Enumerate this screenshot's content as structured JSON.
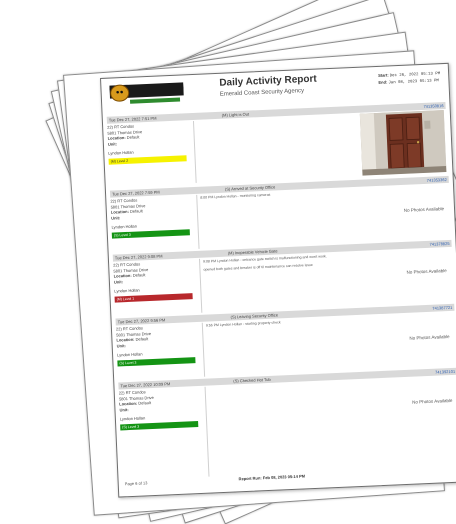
{
  "report": {
    "title": "Daily Activity Report",
    "agency": "Emerald Coast Security Agency",
    "start_label": "Start:",
    "start_value": "Dec 26, 2022 05:13 PM",
    "end_label": "End:",
    "end_value": "Jan 08, 2023 05:13 PM",
    "logo_text_top": "EMERALD COAST",
    "logo_text_bottom": "SECURITY AGENCY"
  },
  "entries": [
    {
      "datetime": "Tue Dec 27, 2022 7:51 PM",
      "event": "(M) Light is Out",
      "id": "741350816",
      "property": "22) RT Condos",
      "address": "5801 Thomas Drive",
      "location_label": "Location:",
      "location": "Default",
      "unit_label": "Unit:",
      "officer": "Lyndon Hollan",
      "level": "(M) Level 2",
      "level_color": "#f6f200",
      "note": "",
      "photo": true,
      "photo_text": ""
    },
    {
      "datetime": "Tue Dec 27, 2022 7:59 PM",
      "event": "(S) Arrived at Security Office",
      "id": "741353362",
      "property": "22) RT Condos",
      "address": "5801 Thomas Drive",
      "location_label": "Location:",
      "location": "Default",
      "unit_label": "Unit:",
      "officer": "Lyndon Hollan",
      "level": "(S) Level 3",
      "level_color": "#149414",
      "note": "8:00 PM Lyndon Hollan - monitoring cameras",
      "photo": false,
      "photo_text": "No Photos Available"
    },
    {
      "datetime": "Tue Dec 27, 2022 9:08 PM",
      "event": "(M) Inoperable Vehicle Gate",
      "id": "741378825",
      "property": "22) RT Condos",
      "address": "5801 Thomas Drive",
      "location_label": "Location:",
      "location": "Default",
      "unit_label": "Unit:",
      "officer": "Lyndon Hollan",
      "level": "(M) Level 1",
      "level_color": "#b8282c",
      "note": "9:08 PM Lyndon Hollan - entrance gate switch is malfunctioning and won't work.",
      "note2": "opened both gates and breaker is off til maintenance can resolve issue",
      "photo": false,
      "photo_text": "No Photos Available"
    },
    {
      "datetime": "Tue Dec 27, 2022 9:56 PM",
      "event": "(S) Leaving Security Office",
      "id": "741387721",
      "property": "22) RT Condos",
      "address": "5801 Thomas Drive",
      "location_label": "Location:",
      "location": "Default",
      "unit_label": "Unit:",
      "officer": "Lyndon Hollan",
      "level": "(S) Level 3",
      "level_color": "#149414",
      "note": "9:56 PM Lyndon Hollan - starting property check",
      "photo": false,
      "photo_text": "No Photos Available"
    },
    {
      "datetime": "Tue Dec 27, 2022 10:09 PM",
      "event": "(S) Checked Hot Tub",
      "id": "741392101",
      "property": "22) RT Condos",
      "address": "5801 Thomas Drive",
      "location_label": "Location:",
      "location": "Default",
      "unit_label": "Unit:",
      "officer": "Lyndon Hollan",
      "level": "(S) Level 3",
      "level_color": "#149414",
      "note": "",
      "photo": false,
      "photo_text": "No Photos Available"
    }
  ],
  "footer": {
    "page": "Page 6 of 13",
    "run": "Report Run: Feb 08, 2023 05:14 PM"
  }
}
